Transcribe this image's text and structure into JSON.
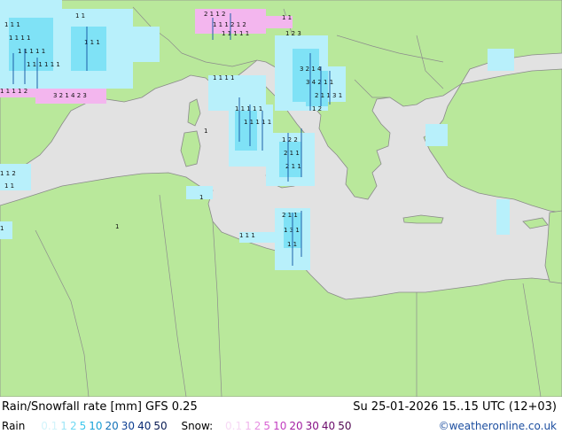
{
  "title": "Rain/Snowfall rate [mm] GFS 0.25",
  "valid_time": "Su 25-01-2026 15..15 UTC (12+03)",
  "credit": "©weatheronline.co.uk",
  "legend": {
    "rain_label": "Rain",
    "rain_levels": [
      {
        "label": "0.1",
        "color": "#d2f4fb"
      },
      {
        "label": "1",
        "color": "#9ee6f7"
      },
      {
        "label": "2",
        "color": "#6ed8f2"
      },
      {
        "label": "5",
        "color": "#3cc6ec"
      },
      {
        "label": "10",
        "color": "#1aa3d8"
      },
      {
        "label": "20",
        "color": "#1372b8"
      },
      {
        "label": "30",
        "color": "#0d3f93"
      },
      {
        "label": "40",
        "color": "#0a2a73"
      },
      {
        "label": "50",
        "color": "#071a52"
      }
    ],
    "snow_label": "Snow:",
    "snow_levels": [
      {
        "label": "0.1",
        "color": "#f7d9f5"
      },
      {
        "label": "1",
        "color": "#f0b6ec"
      },
      {
        "label": "2",
        "color": "#e78fe2"
      },
      {
        "label": "5",
        "color": "#d964d4"
      },
      {
        "label": "10",
        "color": "#c23ec0"
      },
      {
        "label": "20",
        "color": "#a41fa3"
      },
      {
        "label": "30",
        "color": "#861085"
      },
      {
        "label": "40",
        "color": "#6b0b6b"
      },
      {
        "label": "50",
        "color": "#520852"
      }
    ]
  },
  "colors": {
    "land": "#b9e89b",
    "sea": "#e2e2e2",
    "coast": "#8a8a8a",
    "border": "#8c8c8c",
    "rain_light": "#b8f0fb",
    "rain_mid": "#7fe2f6",
    "snow": "#f3b6ee",
    "dark_rain": "#1c5fa8"
  }
}
